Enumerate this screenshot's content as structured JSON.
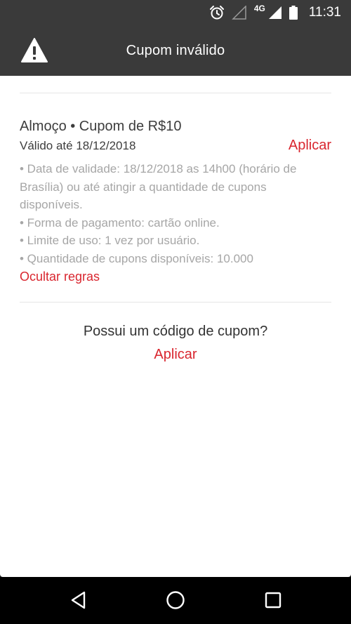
{
  "status_bar": {
    "network": "4G",
    "time": "11:31",
    "icons": [
      "alarm-icon",
      "signal-empty-icon",
      "signal-icon",
      "battery-icon"
    ]
  },
  "app_bar": {
    "icon": "warning-icon",
    "title": "Cupom inválido"
  },
  "coupon": {
    "title": "Almoço • Cupom de R$10",
    "validity": "Válido até 18/12/2018",
    "apply_label": "Aplicar",
    "rules": [
      "• Data de validade: 18/12/2018 as 14h00 (horário de Brasília) ou até atingir a quantidade de cupons disponíveis.",
      "• Forma de pagamento: cartão online.",
      "• Limite de uso: 1 vez por usuário.",
      "• Quantidade de cupons disponíveis: 10.000"
    ],
    "hide_rules_label": "Ocultar regras"
  },
  "code_prompt": {
    "question": "Possui um código de cupom?",
    "apply_label": "Aplicar"
  },
  "nav_bar": {
    "icons": [
      "back-icon",
      "home-icon",
      "recents-icon"
    ]
  },
  "colors": {
    "accent": "#d9262f",
    "app_bar": "#3a3a3a",
    "text_primary": "#3d3d3d",
    "text_secondary": "#a6a6a6"
  }
}
